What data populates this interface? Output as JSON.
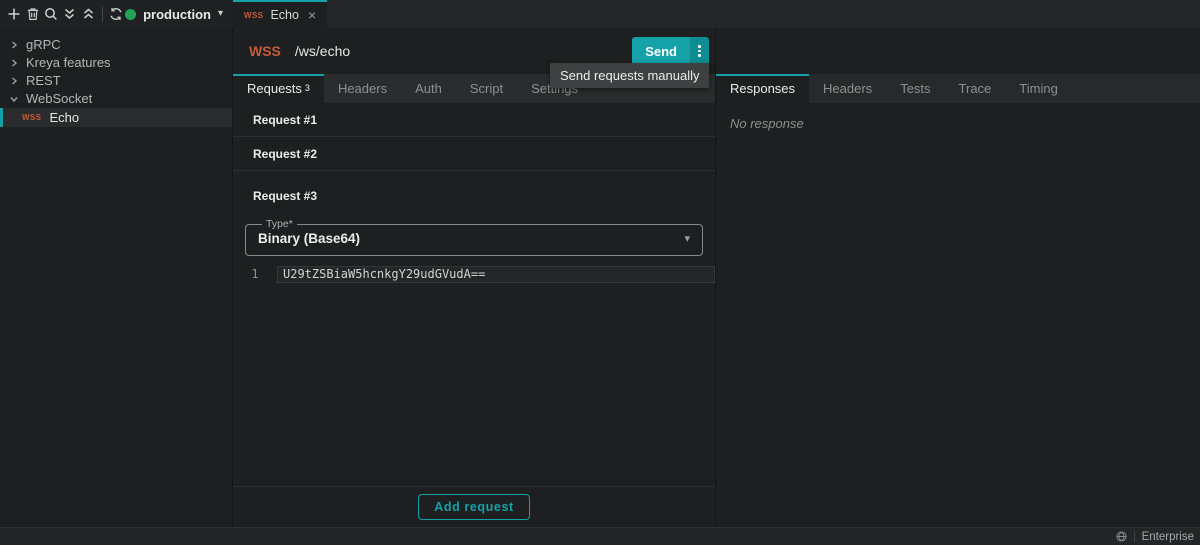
{
  "colors": {
    "accent": "#14a2a8",
    "accent_dark": "#0e8d93",
    "wss_orange": "#c75b39",
    "env_green": "#23a455"
  },
  "icons": {
    "toolbar": [
      "add-icon",
      "delete-icon",
      "search-icon",
      "expand-all-icon",
      "collapse-all-icon",
      "sync-icon"
    ],
    "caret_down": "▾",
    "close": "×",
    "globe": "globe-icon"
  },
  "toolbar": {
    "environment": "production"
  },
  "sidebar": {
    "items": [
      {
        "label": "gRPC"
      },
      {
        "label": "Kreya features"
      },
      {
        "label": "REST"
      },
      {
        "label": "WebSocket"
      },
      {
        "label": "Echo",
        "badge": "WSS"
      }
    ]
  },
  "doc_tab": {
    "badge": "WSS",
    "title": "Echo",
    "close": "×"
  },
  "request_bar": {
    "scheme": "WSS",
    "path": "/ws/echo",
    "send": "Send"
  },
  "tooltip": "Send requests manually",
  "main_tabs": [
    {
      "label": "Requests",
      "count": "3"
    },
    {
      "label": "Headers"
    },
    {
      "label": "Auth"
    },
    {
      "label": "Script"
    },
    {
      "label": "Settings"
    }
  ],
  "requests": [
    {
      "title": "Request #1"
    },
    {
      "title": "Request #2"
    },
    {
      "title": "Request #3",
      "type_label": "Type*",
      "type_value": "Binary (Base64)",
      "editor_line_number": "1",
      "editor_content": "U29tZSBiaW5hcnkgY29udGVudA=="
    }
  ],
  "add_request": "Add request",
  "response_tabs": [
    {
      "label": "Responses"
    },
    {
      "label": "Headers"
    },
    {
      "label": "Tests"
    },
    {
      "label": "Trace"
    },
    {
      "label": "Timing"
    }
  ],
  "response_placeholder": "No response",
  "status_bar": {
    "license": "Enterprise"
  }
}
